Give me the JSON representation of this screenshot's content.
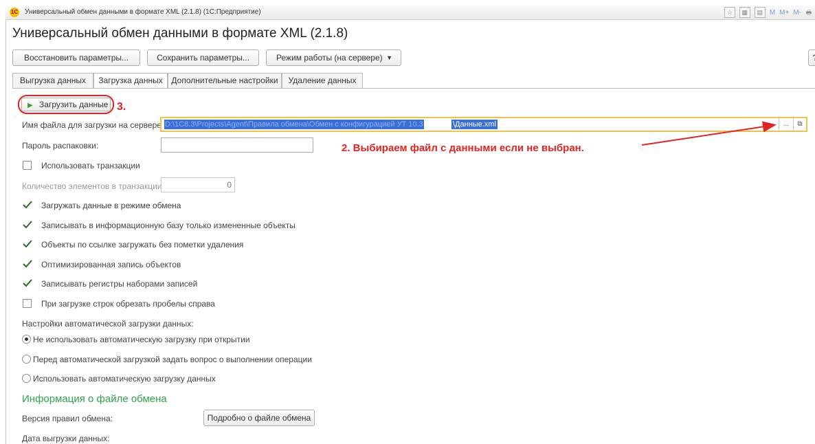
{
  "window": {
    "title": "Универсальный обмен данными в формате XML (2.1.8)  (1С:Предприятие)",
    "logo_text": "1C",
    "toolbar_texts": [
      "M",
      "M+",
      "M-"
    ]
  },
  "page_title": "Универсальный обмен данными в формате XML (2.1.8)",
  "buttons": {
    "restore": "Восстановить параметры...",
    "save": "Сохранить параметры...",
    "mode": "Режим работы (на сервере)",
    "help": "?"
  },
  "tabs": [
    {
      "label": "Выгрузка данных",
      "active": false
    },
    {
      "label": "Загрузка данных",
      "active": true
    },
    {
      "label": "Дополнительные настройки",
      "active": false
    },
    {
      "label": "Удаление данных",
      "active": false
    }
  ],
  "load_button": "Загрузить данные",
  "annotations": {
    "step3": "3.",
    "step2": "2. Выбираем файл с данными если не выбран.",
    "color": "#e52222"
  },
  "fields": {
    "file_label": "Имя файла для загрузки на сервере:",
    "file_value_selected": "D:\\1С8.3\\Projects\\Agent\\Правила обмена\\Обмен с конфигурацией УТ 10.3",
    "file_value_tail": "\\Данные.xml",
    "file_choose": "...",
    "password_label": "Пароль распаковки:",
    "password_value": "",
    "use_transactions": "Использовать транзакции",
    "tx_count_label": "Количество элементов в транзакции:",
    "tx_count_value": "0"
  },
  "checkboxes": [
    {
      "label": "Загружать данные в режиме обмена",
      "checked": true
    },
    {
      "label": "Записывать в информационную базу только измененные объекты",
      "checked": true
    },
    {
      "label": "Объекты по ссылке загружать без пометки удаления",
      "checked": true
    },
    {
      "label": "Оптимизированная запись объектов",
      "checked": true
    },
    {
      "label": "Записывать регистры наборами записей",
      "checked": true
    },
    {
      "label": "При загрузке строк обрезать пробелы справа",
      "checked": false
    }
  ],
  "auto_load": {
    "heading": "Настройки автоматической загрузки данных:",
    "options": [
      {
        "label": "Не использовать автоматическую загрузку при открытии",
        "selected": true
      },
      {
        "label": "Перед автоматической загрузкой задать вопрос о выполнении операции",
        "selected": false
      },
      {
        "label": "Использовать автоматическую загрузку данных",
        "selected": false
      }
    ]
  },
  "exchange_info": {
    "heading": "Информация о файле обмена",
    "rules_version_label": "Версия правил обмена:",
    "details_button": "Подробно о файле обмена",
    "export_date_label": "Дата выгрузки данных:"
  },
  "colors": {
    "green_heading": "#2da44e",
    "highlight": "#3b6fd8",
    "field_border": "#f0c24a"
  }
}
